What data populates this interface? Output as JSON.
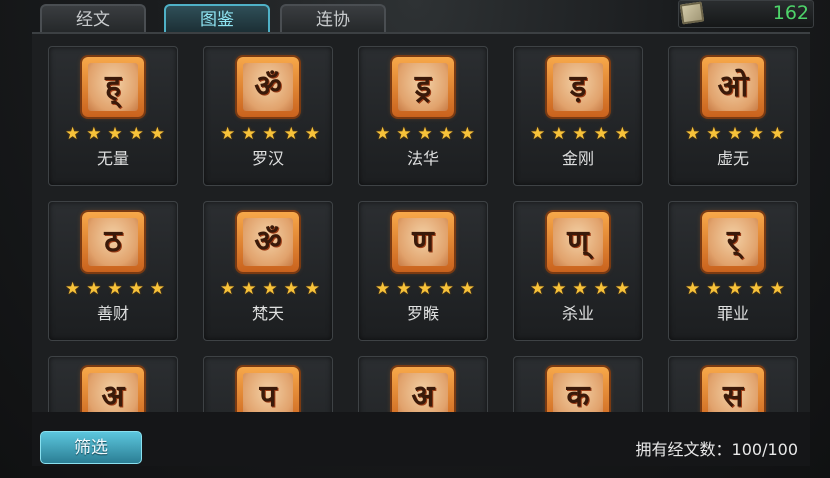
{
  "tabs": [
    {
      "label": "经文",
      "active": false
    },
    {
      "label": "图鉴",
      "active": true
    },
    {
      "label": "连协",
      "active": false
    }
  ],
  "currency": {
    "icon": "scroll-icon",
    "value": "162",
    "color": "#4ed46a"
  },
  "cards": [
    {
      "name": "无量",
      "glyph": "ह्",
      "stars": 5
    },
    {
      "name": "罗汉",
      "glyph": "ॐ",
      "stars": 5
    },
    {
      "name": "法华",
      "glyph": "ड्र",
      "stars": 5
    },
    {
      "name": "金刚",
      "glyph": "ड़",
      "stars": 5
    },
    {
      "name": "虚无",
      "glyph": "ओ",
      "stars": 5
    },
    {
      "name": "善财",
      "glyph": "ठ",
      "stars": 5
    },
    {
      "name": "梵天",
      "glyph": "ॐ",
      "stars": 5
    },
    {
      "name": "罗睺",
      "glyph": "ण",
      "stars": 5
    },
    {
      "name": "杀业",
      "glyph": "ण्",
      "stars": 5
    },
    {
      "name": "罪业",
      "glyph": "र्",
      "stars": 5
    },
    {
      "name": "",
      "glyph": "अ",
      "stars": 0
    },
    {
      "name": "",
      "glyph": "प",
      "stars": 0
    },
    {
      "name": "",
      "glyph": "अ",
      "stars": 0
    },
    {
      "name": "",
      "glyph": "क",
      "stars": 0
    },
    {
      "name": "",
      "glyph": "स",
      "stars": 0
    }
  ],
  "filter_button": {
    "label": "筛选"
  },
  "owned_count": {
    "label": "拥有经文数：",
    "value": "100/100"
  },
  "colors": {
    "accent": "#4fb1c7",
    "star": "#f7c23a",
    "icon_frame": "#e0883a"
  }
}
